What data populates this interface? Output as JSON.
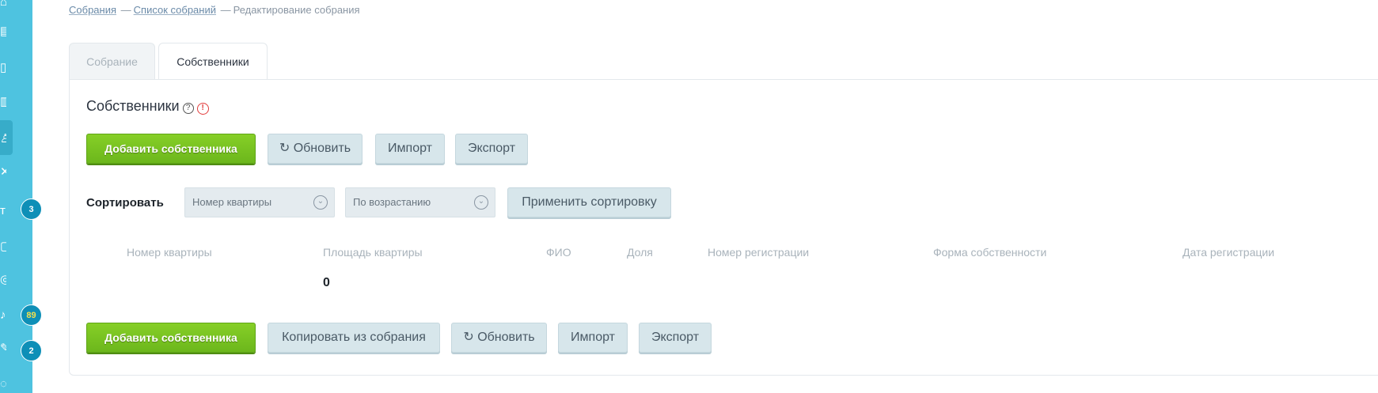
{
  "sidebar": {
    "badges": [
      "3",
      "89",
      "2"
    ]
  },
  "breadcrumb": {
    "item1": "Собрания",
    "item2": "Список собраний",
    "current": "Редактирование собрания",
    "separator": "—"
  },
  "tabs": {
    "meeting": "Собрание",
    "owners": "Собственники"
  },
  "section": {
    "title": "Собственники",
    "help_glyph": "?",
    "warn_glyph": "!"
  },
  "top_toolbar": {
    "add": "Добавить собственника",
    "refresh": "↻ Обновить",
    "import": "Импорт",
    "export": "Экспорт"
  },
  "sorting": {
    "label": "Сортировать",
    "field_selected": "Номер квартиры",
    "order_selected": "По возрастанию",
    "apply": "Применить сортировку"
  },
  "table": {
    "columns": [
      "Номер квартиры",
      "Площадь квартиры",
      "ФИО",
      "Доля",
      "Номер регистрации",
      "Форма собственности",
      "Дата регистрации"
    ],
    "total_area": "0"
  },
  "bottom_toolbar": {
    "add": "Добавить собственника",
    "copy": "Копировать из собрания",
    "refresh": "↻ Обновить",
    "import": "Импорт",
    "export": "Экспорт"
  },
  "colors": {
    "sidebar": "#4ec3e0",
    "accent_green": "#7cc322",
    "badge": "#0e8fb7"
  }
}
